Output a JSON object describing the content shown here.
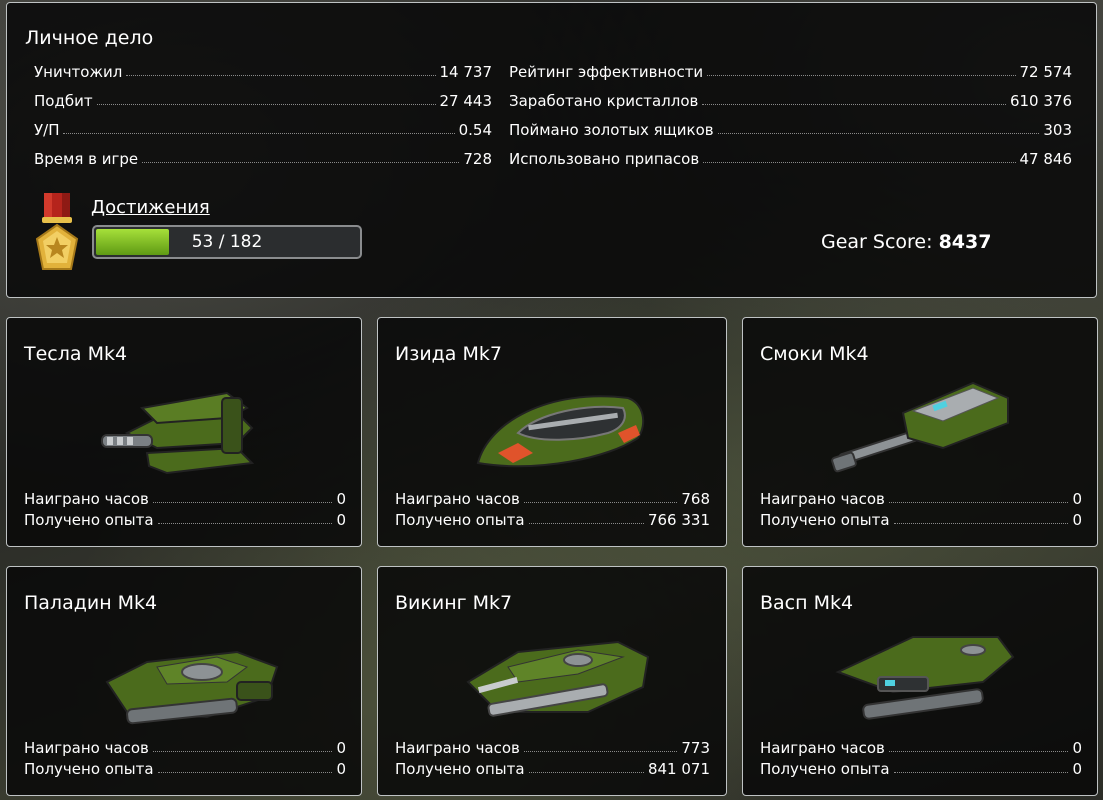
{
  "profile": {
    "title": "Личное дело",
    "left_stats": [
      {
        "label": "Уничтожил",
        "value": "14 737"
      },
      {
        "label": "Подбит",
        "value": "27 443"
      },
      {
        "label": "У/П",
        "value": "0.54"
      },
      {
        "label": "Время в игре",
        "value": "728"
      }
    ],
    "right_stats": [
      {
        "label": "Рейтинг эффективности",
        "value": "72 574"
      },
      {
        "label": "Заработано кристаллов",
        "value": "610 376"
      },
      {
        "label": "Поймано золотых ящиков",
        "value": "303"
      },
      {
        "label": "Использовано припасов",
        "value": "47 846"
      }
    ],
    "achievements": {
      "label": "Достижения",
      "progress_text": "53 / 182",
      "progress_fraction": 0.291
    },
    "gear_score": {
      "label": "Gear Score:",
      "value": "8437"
    }
  },
  "cards": [
    {
      "name": "Тесла Mk4",
      "hours_label": "Наиграно часов",
      "hours": "0",
      "xp_label": "Получено опыта",
      "xp": "0",
      "icon": "tesla-turret-icon"
    },
    {
      "name": "Изида Mk7",
      "hours_label": "Наиграно часов",
      "hours": "768",
      "xp_label": "Получено опыта",
      "xp": "766 331",
      "icon": "isida-turret-icon"
    },
    {
      "name": "Смоки Mk4",
      "hours_label": "Наиграно часов",
      "hours": "0",
      "xp_label": "Получено опыта",
      "xp": "0",
      "icon": "smoky-turret-icon"
    },
    {
      "name": "Паладин Mk4",
      "hours_label": "Наиграно часов",
      "hours": "0",
      "xp_label": "Получено опыта",
      "xp": "0",
      "icon": "paladin-hull-icon"
    },
    {
      "name": "Викинг Mk7",
      "hours_label": "Наиграно часов",
      "hours": "773",
      "xp_label": "Получено опыта",
      "xp": "841 071",
      "icon": "viking-hull-icon"
    },
    {
      "name": "Васп Mk4",
      "hours_label": "Наиграно часов",
      "hours": "0",
      "xp_label": "Получено опыта",
      "xp": "0",
      "icon": "wasp-hull-icon"
    }
  ],
  "colors": {
    "accent_green": "#5f9a14",
    "panel_border": "#bfc3c4",
    "hull_green": "#4d6b1e"
  }
}
